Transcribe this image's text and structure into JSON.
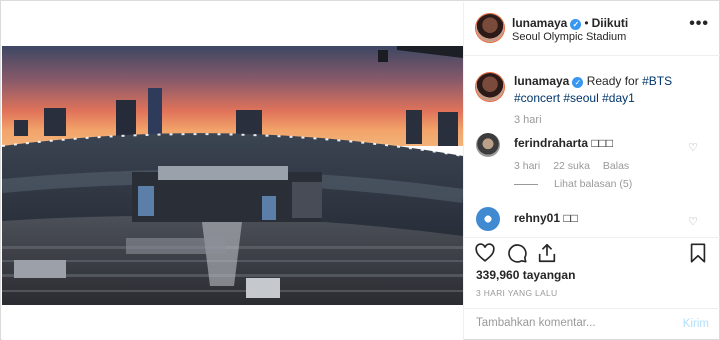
{
  "post": {
    "username": "lunamaya",
    "follow_status": "Diikuti",
    "separator": "•",
    "location": "Seoul Olympic Stadium",
    "more_label": "•••"
  },
  "caption": {
    "username": "lunamaya",
    "text": "Ready for",
    "hashtags": [
      "#BTS",
      "#concert",
      "#seoul",
      "#day1"
    ],
    "time": "3 hari"
  },
  "comments": [
    {
      "username": "ferindraharta",
      "text": "□□□",
      "time": "3 hari",
      "likes": "22 suka",
      "reply_label": "Balas",
      "view_replies": "Lihat balasan (5)"
    },
    {
      "username": "rehny01",
      "text": "□□"
    }
  ],
  "stats": {
    "views": "339,960 tayangan",
    "date": "3 HARI YANG LALU"
  },
  "comment_box": {
    "placeholder": "Tambahkan komentar...",
    "post_label": "Kirim"
  },
  "icons": {
    "verified": "verified-badge-icon",
    "like": "heart-icon",
    "comment": "comment-bubble-icon",
    "share": "share-icon",
    "save": "bookmark-icon"
  },
  "colors": {
    "accent": "#3897f0",
    "hashtag": "#003569",
    "muted": "#999999",
    "post_disabled": "#b2dffc"
  }
}
